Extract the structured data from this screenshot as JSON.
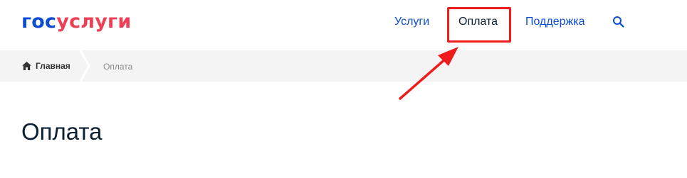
{
  "header": {
    "logo": {
      "part1": "гос",
      "part2": "услуги"
    },
    "nav": {
      "services_label": "Услуги",
      "payment_label": "Оплата",
      "support_label": "Поддержка"
    },
    "search_icon": "search-icon"
  },
  "breadcrumb": {
    "home_icon": "home-icon",
    "home_label": "Главная",
    "current_label": "Оплата"
  },
  "main": {
    "title": "Оплата"
  },
  "annotation": {
    "highlight_target": "nav-payment",
    "color": "#ee1c1c"
  },
  "colors": {
    "brand_blue": "#0d4cd3",
    "brand_red": "#ee3f58",
    "text_dark": "#0b1f33",
    "breadcrumb_bg": "#f4f4f4"
  }
}
